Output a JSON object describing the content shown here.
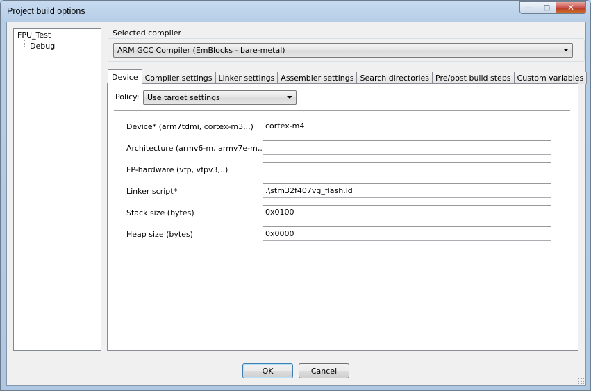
{
  "window": {
    "title": "Project build options",
    "caption_buttons": {
      "minimize": "—",
      "maximize": "□",
      "close": "✕"
    }
  },
  "tree": {
    "root": "FPU_Test",
    "child": "Debug"
  },
  "compiler": {
    "label": "Selected compiler",
    "selected": "ARM GCC Compiler (EmBlocks - bare-metal)"
  },
  "tabs": [
    {
      "label": "Device",
      "active": true
    },
    {
      "label": "Compiler settings",
      "active": false
    },
    {
      "label": "Linker settings",
      "active": false
    },
    {
      "label": "Assembler settings",
      "active": false
    },
    {
      "label": "Search directories",
      "active": false
    },
    {
      "label": "Pre/post build steps",
      "active": false
    },
    {
      "label": "Custom variables",
      "active": false
    }
  ],
  "policy": {
    "label": "Policy:",
    "selected": "Use target settings"
  },
  "fields": [
    {
      "label": "Device* (arm7tdmi, cortex-m3,..)",
      "value": "cortex-m4"
    },
    {
      "label": "Architecture (armv6-m, armv7e-m,..)",
      "value": ""
    },
    {
      "label": "FP-hardware (vfp, vfpv3,..)",
      "value": ""
    },
    {
      "label": "Linker script*",
      "value": ".\\stm32f407vg_flash.ld"
    },
    {
      "label": "Stack size (bytes)",
      "value": "0x0100"
    },
    {
      "label": "Heap size (bytes)",
      "value": "0x0000"
    }
  ],
  "buttons": {
    "ok": "OK",
    "cancel": "Cancel"
  }
}
